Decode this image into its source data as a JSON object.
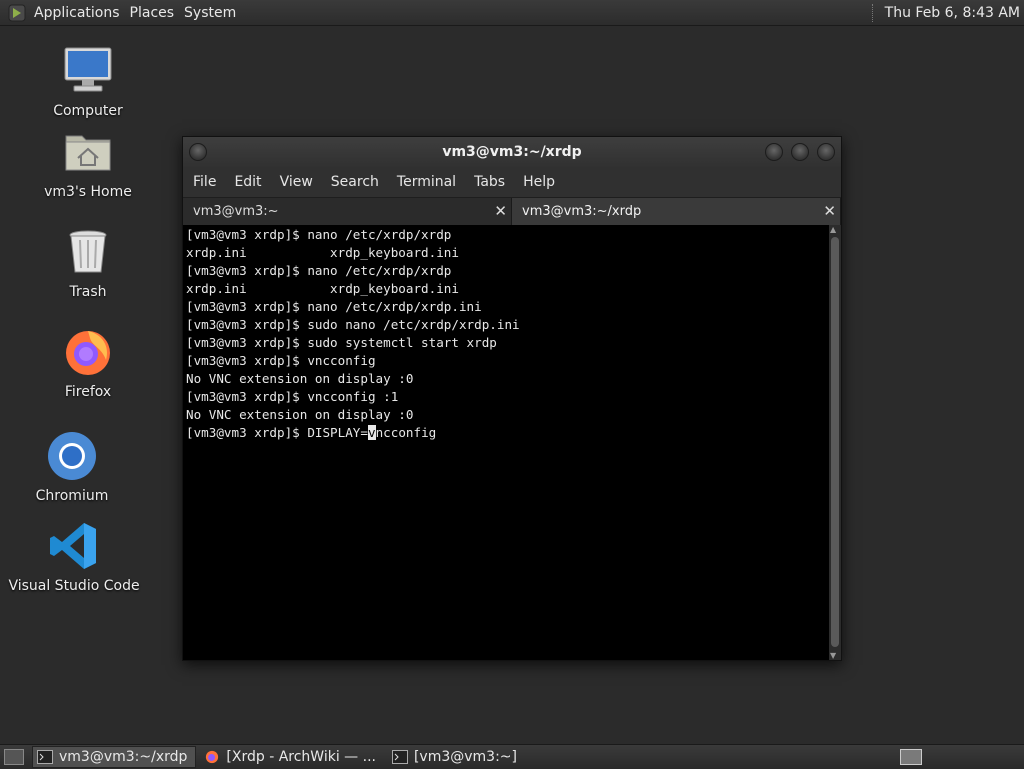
{
  "top_panel": {
    "menus": [
      "Applications",
      "Places",
      "System"
    ],
    "clock": "Thu Feb  6,  8:43 AM"
  },
  "desktop": {
    "icons": [
      {
        "label": "Computer",
        "icon": "computer-icon"
      },
      {
        "label": "vm3's Home",
        "icon": "home-folder-icon"
      },
      {
        "label": "Trash",
        "icon": "trash-icon"
      },
      {
        "label": "Firefox",
        "icon": "firefox-icon"
      },
      {
        "label": "Chromium",
        "icon": "chromium-icon"
      },
      {
        "label": "Visual Studio Code",
        "icon": "vscode-icon"
      }
    ]
  },
  "terminal": {
    "title": "vm3@vm3:~/xrdp",
    "menu": [
      "File",
      "Edit",
      "View",
      "Search",
      "Terminal",
      "Tabs",
      "Help"
    ],
    "tabs": [
      {
        "label": "vm3@vm3:~",
        "active": false
      },
      {
        "label": "vm3@vm3:~/xrdp",
        "active": true
      }
    ],
    "lines": [
      "[vm3@vm3 xrdp]$ nano /etc/xrdp/xrdp",
      "xrdp.ini           xrdp_keyboard.ini",
      "[vm3@vm3 xrdp]$ nano /etc/xrdp/xrdp",
      "xrdp.ini           xrdp_keyboard.ini",
      "[vm3@vm3 xrdp]$ nano /etc/xrdp/xrdp.ini",
      "[vm3@vm3 xrdp]$ sudo nano /etc/xrdp/xrdp.ini",
      "[vm3@vm3 xrdp]$ sudo systemctl start xrdp",
      "[vm3@vm3 xrdp]$ vncconfig",
      "No VNC extension on display :0",
      "[vm3@vm3 xrdp]$ vncconfig :1",
      "No VNC extension on display :0"
    ],
    "current_prompt": "[vm3@vm3 xrdp]$ DISPLAY=",
    "cursor_char": "v",
    "after_cursor": "ncconfig"
  },
  "taskbar": {
    "tasks": [
      {
        "label": "vm3@vm3:~/xrdp",
        "icon": "terminal-icon",
        "active": true
      },
      {
        "label": "[Xrdp - ArchWiki — ...",
        "icon": "firefox-icon",
        "active": false
      },
      {
        "label": "[vm3@vm3:~]",
        "icon": "terminal-icon",
        "active": false
      }
    ]
  }
}
